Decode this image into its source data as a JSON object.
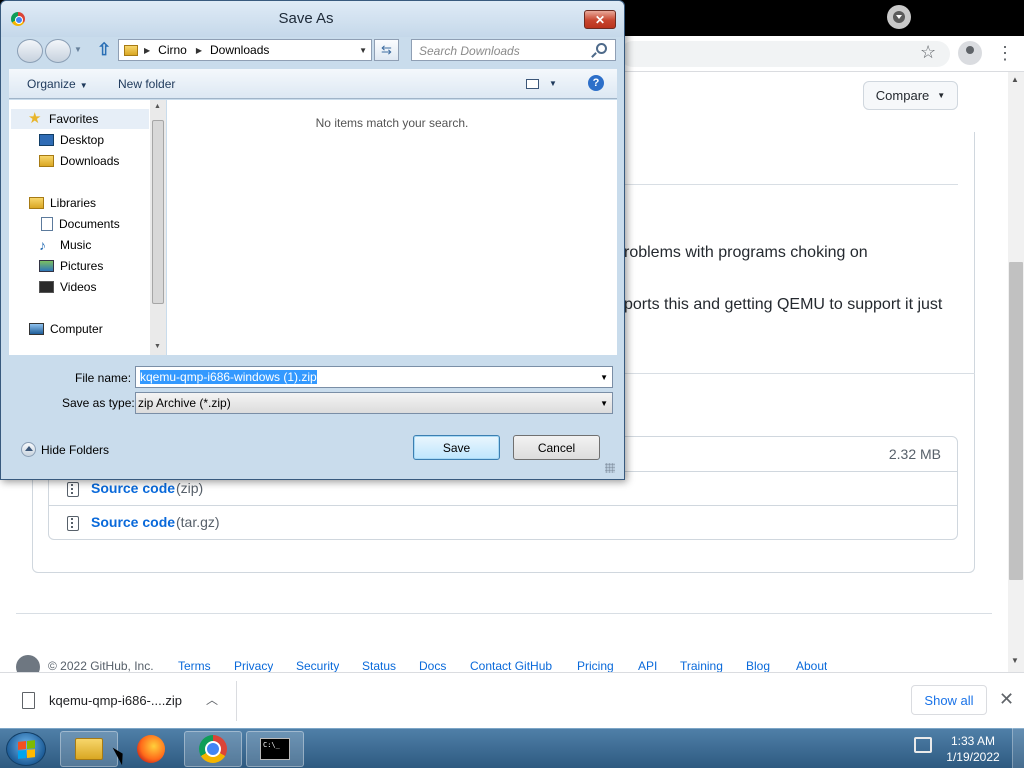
{
  "browser": {
    "page": {
      "compare_label": "Compare",
      "release_text": [
        "roblems with programs choking on",
        "ports this and getting QEMU to support it just"
      ],
      "assets": [
        {
          "name": "",
          "ext": "",
          "size": "2.32 MB"
        },
        {
          "name": "Source code",
          "ext": "(zip)",
          "size": ""
        },
        {
          "name": "Source code",
          "ext": "(tar.gz)",
          "size": ""
        }
      ],
      "footer": {
        "copyright": "© 2022 GitHub, Inc.",
        "links": [
          "Terms",
          "Privacy",
          "Security",
          "Status",
          "Docs",
          "Contact GitHub",
          "Pricing",
          "API",
          "Training",
          "Blog",
          "About"
        ]
      }
    },
    "download_shelf": {
      "filename": "kqemu-qmp-i686-....zip",
      "show_all_label": "Show all"
    }
  },
  "dialog": {
    "title": "Save As",
    "close_label": "✕",
    "breadcrumb": [
      "Cirno",
      "Downloads"
    ],
    "search_placeholder": "Search Downloads",
    "toolbar": {
      "organize_label": "Organize",
      "new_folder_label": "New folder",
      "help_label": "?"
    },
    "nav_pane": {
      "favorites": "Favorites",
      "favorites_items": [
        "Desktop",
        "Downloads"
      ],
      "libraries": "Libraries",
      "libraries_items": [
        "Documents",
        "Music",
        "Pictures",
        "Videos"
      ],
      "computer": "Computer"
    },
    "empty_message": "No items match your search.",
    "file_name_label": "File name:",
    "file_name_value": "kqemu-qmp-i686-windows (1).zip",
    "save_as_type_label": "Save as type:",
    "save_as_type_value": "zip Archive (*.zip)",
    "hide_folders_label": "Hide Folders",
    "save_label": "Save",
    "cancel_label": "Cancel"
  },
  "taskbar": {
    "clock_time": "1:33 AM",
    "clock_date": "1/19/2022",
    "cmd_icon_text": "C:\\_"
  },
  "colors": {
    "link": "#0969da",
    "taskbar": "#2e5a80",
    "dialog_frame": "#c9dcec",
    "selection": "#3399ff"
  }
}
